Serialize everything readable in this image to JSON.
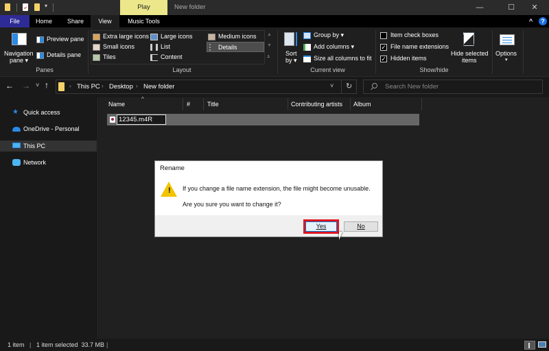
{
  "window": {
    "contextual_tab": "Play",
    "title": "New folder",
    "controls": {
      "minimize": "—",
      "maximize": "☐",
      "close": "✕"
    }
  },
  "tabs": [
    {
      "label": "File",
      "active": false
    },
    {
      "label": "Home",
      "active": false
    },
    {
      "label": "Share",
      "active": false
    },
    {
      "label": "View",
      "active": true
    },
    {
      "label": "Music Tools",
      "active": false
    }
  ],
  "ribbon": {
    "panes": {
      "label": "Panes",
      "navigation_pane": "Navigation",
      "navigation_pane_2": "pane ▾",
      "preview_pane": "Preview pane",
      "details_pane": "Details pane"
    },
    "layout": {
      "label": "Layout",
      "options": [
        "Extra large icons",
        "Large icons",
        "Medium icons",
        "Small icons",
        "List",
        "Details",
        "Tiles",
        "Content"
      ],
      "selected": "Details"
    },
    "current_view": {
      "label": "Current view",
      "sort_by": "Sort",
      "sort_by_2": "by ▾",
      "group_by": "Group by ▾",
      "add_columns": "Add columns ▾",
      "size_columns": "Size all columns to fit"
    },
    "show_hide": {
      "label": "Show/hide",
      "item_check_boxes": {
        "label": "Item check boxes",
        "checked": false
      },
      "file_name_extensions": {
        "label": "File name extensions",
        "checked": true
      },
      "hidden_items": {
        "label": "Hidden items",
        "checked": true
      },
      "hide_selected": "Hide selected",
      "hide_selected_2": "items"
    },
    "options": {
      "label": "Options",
      "arrow": "▾"
    }
  },
  "navigation": {
    "back": "←",
    "forward": "→",
    "recent": "˅",
    "up": "↑",
    "breadcrumb": [
      "This PC",
      "Desktop",
      "New folder"
    ],
    "crumb_sep": "›",
    "dropdown": "˅",
    "refresh": "↻",
    "search_placeholder": "Search New folder"
  },
  "sidebar": {
    "items": [
      {
        "label": "Quick access",
        "selected": false
      },
      {
        "label": "OneDrive - Personal",
        "selected": false
      },
      {
        "label": "This PC",
        "selected": true
      },
      {
        "label": "Network",
        "selected": false
      }
    ]
  },
  "file_list": {
    "columns": [
      "Name",
      "#",
      "Title",
      "Contributing artists",
      "Album"
    ],
    "sort_indicator": "^",
    "rows": [
      {
        "name": "12345.m4R",
        "renaming": true
      }
    ]
  },
  "dialog": {
    "title": "Rename",
    "message": "If you change a file name extension, the file might become unusable.",
    "question": "Are you sure you want to change it?",
    "yes": "Yes",
    "no": "No",
    "highlight_color": "#e0141e"
  },
  "status": {
    "item_count": "1 item",
    "selection": "1 item selected  33.7 MB",
    "sep": "|"
  }
}
